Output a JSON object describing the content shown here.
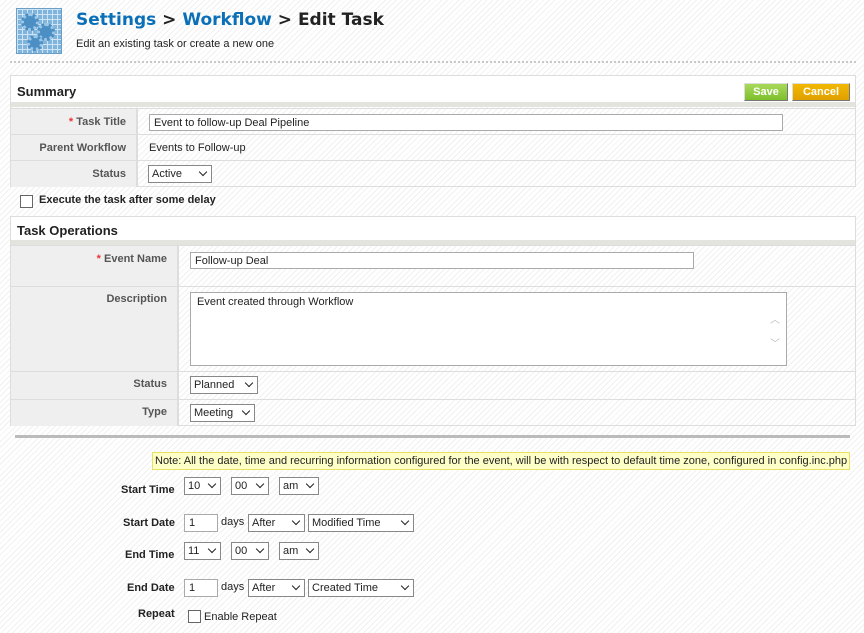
{
  "header": {
    "crumb1": "Settings",
    "sep": ">",
    "crumb2": "Workflow",
    "crumb3": "Edit Task",
    "subtitle": "Edit an existing task or create a new one"
  },
  "summary": {
    "title": "Summary",
    "save": "Save",
    "cancel": "Cancel",
    "task_title_label": "Task Title",
    "task_title_value": "Event to follow-up Deal Pipeline",
    "parent_label": "Parent Workflow",
    "parent_value": "Events to Follow-up",
    "status_label": "Status",
    "status_value": "Active"
  },
  "delay": {
    "label": "Execute the task after some delay",
    "checked": false
  },
  "ops": {
    "title": "Task Operations",
    "event_name_label": "Event Name",
    "event_name_value": "Follow-up Deal",
    "description_label": "Description",
    "description_value": "Event created through Workflow",
    "status_label": "Status",
    "status_value": "Planned",
    "type_label": "Type",
    "type_value": "Meeting"
  },
  "note": "Note: All the date, time and recurring information configured for the event, will be with respect to default time zone, configured in config.inc.php",
  "schedule": {
    "start_time_label": "Start Time",
    "start_hour": "10",
    "start_min": "00",
    "start_ampm": "am",
    "start_date_label": "Start Date",
    "start_days": "1",
    "days": "days",
    "start_dir": "After",
    "start_ref": "Modified Time",
    "end_time_label": "End Time",
    "end_hour": "11",
    "end_min": "00",
    "end_ampm": "am",
    "end_date_label": "End Date",
    "end_days": "1",
    "end_dir": "After",
    "end_ref": "Created Time",
    "repeat_label": "Repeat",
    "enable_repeat": "Enable Repeat"
  }
}
